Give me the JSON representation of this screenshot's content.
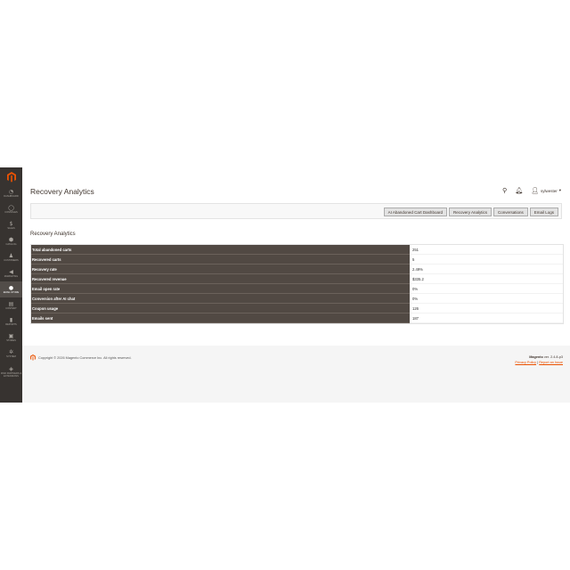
{
  "colors": {
    "sidebar_bg": "#373330",
    "brand_orange": "#eb5202",
    "table_header_bg": "#514943"
  },
  "sidebar": {
    "logo": "magento-logo",
    "items": [
      {
        "label": "Dashboard",
        "icon": "speedometer-icon",
        "glyph": "◔"
      },
      {
        "label": "Consoles",
        "icon": "console-icon",
        "glyph": "◯"
      },
      {
        "label": "Sales",
        "icon": "dollar-icon",
        "glyph": "$"
      },
      {
        "label": "Catalog",
        "icon": "cube-icon",
        "glyph": "⬢"
      },
      {
        "label": "Customers",
        "icon": "person-icon",
        "glyph": "♟"
      },
      {
        "label": "Marketing",
        "icon": "megaphone-icon",
        "glyph": "◀"
      },
      {
        "label": "Email.store",
        "icon": "email-icon",
        "glyph": "●"
      },
      {
        "label": "Content",
        "icon": "layout-icon",
        "glyph": "▤"
      },
      {
        "label": "Reports",
        "icon": "bar-chart-icon",
        "glyph": "▮"
      },
      {
        "label": "Stores",
        "icon": "store-icon",
        "glyph": "▣"
      },
      {
        "label": "System",
        "icon": "gear-icon",
        "glyph": "✲"
      },
      {
        "label": "Find Partners & Extensions",
        "icon": "boxes-icon",
        "glyph": "◈"
      }
    ]
  },
  "header": {
    "title": "Recovery Analytics",
    "username": "sylwester"
  },
  "toolbar": {
    "buttons": [
      "AI Abandoned Cart Dashboard",
      "Recovery Analytics",
      "Conversations",
      "Email Logs"
    ]
  },
  "section": {
    "title": "Recovery Analytics"
  },
  "stats": [
    {
      "label": "Total abandoned carts",
      "value": "251"
    },
    {
      "label": "Recovered carts",
      "value": "5"
    },
    {
      "label": "Recovery rate",
      "value": "2.49%"
    },
    {
      "label": "Recovered revenue",
      "value": "$335.2"
    },
    {
      "label": "Email open rate",
      "value": "0%"
    },
    {
      "label": "Conversion after AI chat",
      "value": "0%"
    },
    {
      "label": "Coupon usage",
      "value": "126"
    },
    {
      "label": "Emails sent",
      "value": "187"
    }
  ],
  "footer": {
    "copyright": "Copyright © 2026 Magento Commerce Inc. All rights reserved.",
    "brand": "Magento",
    "version": "ver. 2.4.8-p3",
    "privacy": "Privacy Policy",
    "separator": "|",
    "report": "Report an Issue"
  }
}
